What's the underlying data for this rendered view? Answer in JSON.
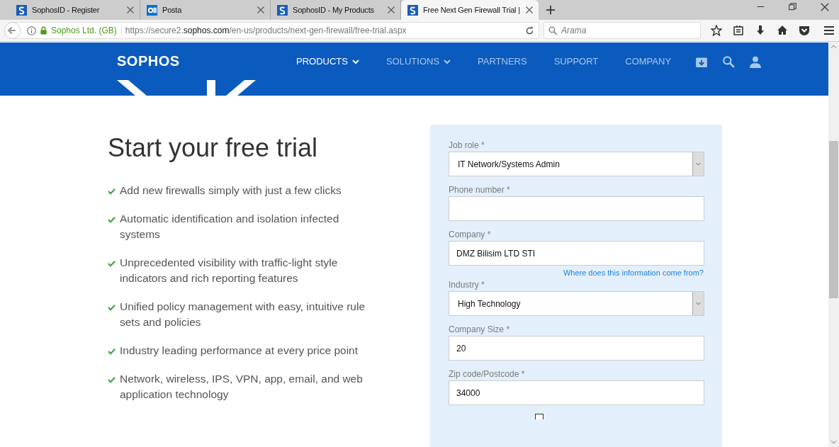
{
  "browser": {
    "tabs": [
      {
        "title": "SophosID - Register",
        "selected": false
      },
      {
        "title": "Posta",
        "selected": false
      },
      {
        "title": "SophosID - My Products",
        "selected": false
      },
      {
        "title": "Free Next Gen Firewall Trial |",
        "selected": true
      }
    ],
    "identity": "Sophos Ltd. (GB)",
    "url": {
      "scheme_host": "https://secure2.",
      "domain": "sophos.com",
      "path": "/en-us/products/next-gen-firewall/free-trial.aspx"
    },
    "search": {
      "placeholder": "Arama"
    }
  },
  "nav": {
    "logo": "SOPHOS",
    "items": [
      {
        "label": "PRODUCTS",
        "dropdown": true,
        "selected": true
      },
      {
        "label": "SOLUTIONS",
        "dropdown": true,
        "selected": false
      },
      {
        "label": "PARTNERS",
        "dropdown": false,
        "selected": false
      },
      {
        "label": "SUPPORT",
        "dropdown": false,
        "selected": false
      },
      {
        "label": "COMPANY",
        "dropdown": false,
        "selected": false
      }
    ]
  },
  "hero": {
    "title": "Start your free trial",
    "features": [
      "Add new firewalls simply with just a few clicks",
      "Automatic identification and isolation infected systems",
      "Unprecedented visibility with traffic-light style indicators and rich reporting features",
      "Unified policy management with easy, intuitive rule sets and policies",
      "Industry leading performance at every price point",
      "Network, wireless, IPS, VPN, app, email, and web application technology"
    ]
  },
  "form": {
    "fields": [
      {
        "kind": "select",
        "label": "Job role",
        "mark": "*",
        "value": "IT Network/Systems Admin"
      },
      {
        "kind": "text",
        "label": "Phone number",
        "mark": "*"
      },
      {
        "kind": "text",
        "label": "Company",
        "mark": "*",
        "value": "DMZ Bilisim LTD STI"
      },
      {
        "kind": "link",
        "label": "Where does this information come from?"
      },
      {
        "kind": "select",
        "label": "Industry",
        "mark": "*",
        "value": "High Technology"
      },
      {
        "kind": "text",
        "label": "Company Size",
        "mark": "*",
        "value": "20"
      },
      {
        "kind": "text",
        "label": "Zip code/Postcode",
        "mark": "*",
        "value": "34000"
      }
    ]
  }
}
